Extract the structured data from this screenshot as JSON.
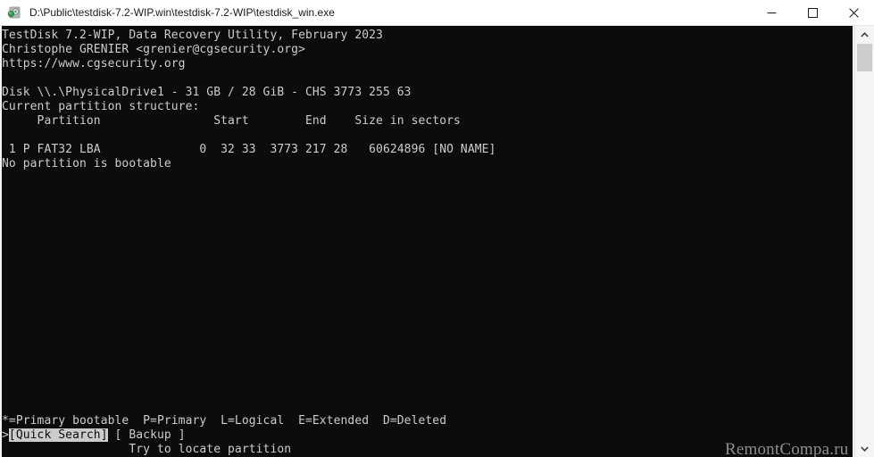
{
  "titlebar": {
    "icon": "testdisk-app-icon",
    "title": "D:\\Public\\testdisk-7.2-WIP.win\\testdisk-7.2-WIP\\testdisk_win.exe",
    "minimize_label": "minimize-icon",
    "maximize_label": "maximize-icon",
    "close_label": "close-icon"
  },
  "console": {
    "background_color": "#0c0c0c",
    "foreground_color": "#cccccc",
    "highlight_background": "#cccccc",
    "highlight_foreground": "#0c0c0c",
    "header": {
      "line1": "TestDisk 7.2-WIP, Data Recovery Utility, February 2023",
      "line2": "Christophe GRENIER <grenier@cgsecurity.org>",
      "line3": "https://www.cgsecurity.org"
    },
    "disk": {
      "line": "Disk \\\\.\\PhysicalDrive1 - 31 GB / 28 GiB - CHS 3773 255 63",
      "device": "\\\\.\\PhysicalDrive1",
      "size_gb": "31 GB",
      "size_gib": "28 GiB",
      "chs": "CHS 3773 255 63"
    },
    "structure_label": "Current partition structure:",
    "table": {
      "header": "     Partition                Start        End    Size in sectors",
      "columns": [
        "Partition",
        "Start",
        "End",
        "Size in sectors"
      ],
      "rows": [
        {
          "line": " 1 P FAT32 LBA              0  32 33  3773 217 28   60624896 [NO NAME]",
          "index": "1",
          "type": "P",
          "fs": "FAT32 LBA",
          "start": "0  32 33",
          "end": "3773 217 28",
          "size_in_sectors": "60624896",
          "label": "[NO NAME]"
        }
      ]
    },
    "boot_status": "No partition is bootable",
    "legend": "*=Primary bootable  P=Primary  L=Logical  E=Extended  D=Deleted",
    "legend_items": [
      "*=Primary bootable",
      "P=Primary",
      "L=Logical",
      "E=Extended",
      "D=Deleted"
    ],
    "menu": {
      "cursor": ">",
      "selected": "[Quick Search]",
      "selected_label": "Quick Search",
      "other": " [ Backup ]",
      "other_label": "Backup"
    },
    "hint": "                  Try to locate partition"
  },
  "watermark": {
    "text": "RemontCompa.ru"
  },
  "scrollbar": {
    "up_arrow": "chevron-up-icon",
    "down_arrow": "chevron-down-icon",
    "thumb": "scrollbar-thumb"
  }
}
